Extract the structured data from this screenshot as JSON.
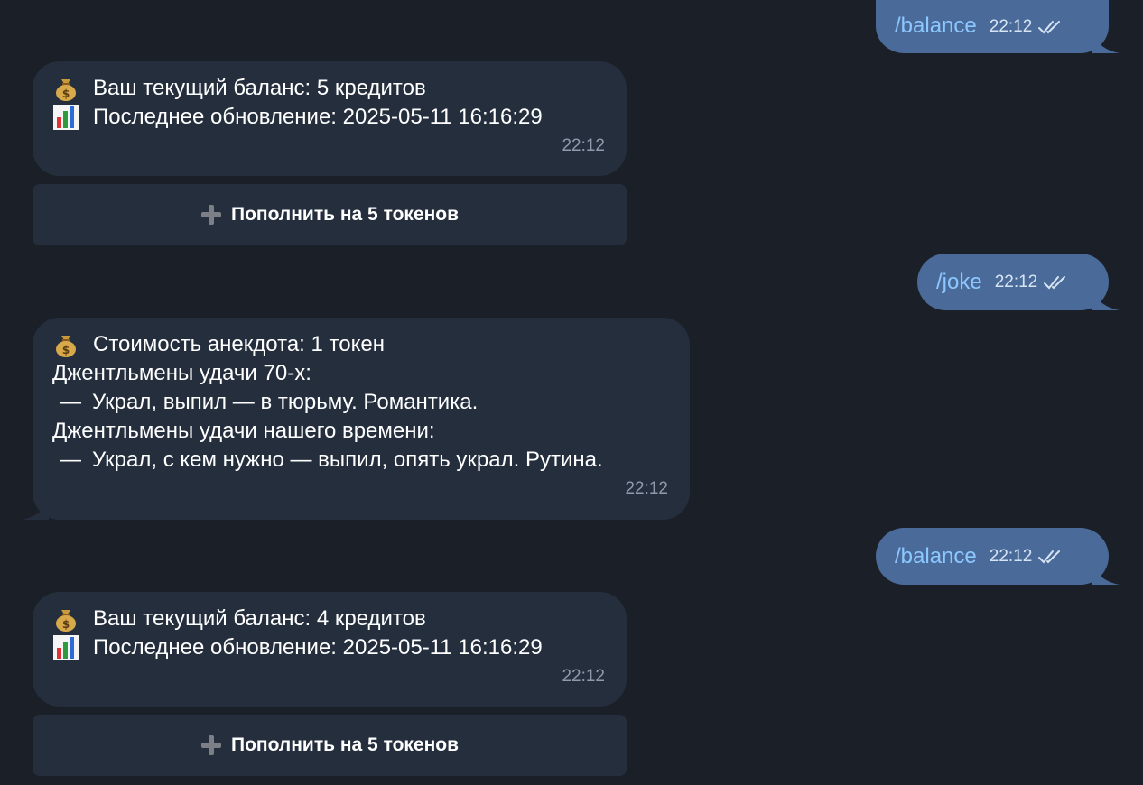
{
  "messages": {
    "out1": {
      "text": "/balance",
      "time": "22:12"
    },
    "in1": {
      "line1": "Ваш текущий баланс: 5 кредитов",
      "line2": "Последнее обновление: 2025-05-11 16:16:29",
      "time": "22:12",
      "button": "Пополнить на 5 токенов"
    },
    "out2": {
      "text": "/joke",
      "time": "22:12"
    },
    "in2": {
      "line1": "Стоимость анекдота: 1 токен",
      "line2": "Джентльмены удачи 70-х:",
      "line3": "Украл, выпил — в тюрьму. Романтика.",
      "line4": "Джентльмены удачи нашего времени:",
      "line5": "Украл, с кем нужно — выпил, опять украл. Рутина.",
      "dash": "—",
      "time": "22:12"
    },
    "out3": {
      "text": "/balance",
      "time": "22:12"
    },
    "in3": {
      "line1": "Ваш текущий баланс: 4 кредитов",
      "line2": "Последнее обновление: 2025-05-11 16:16:29",
      "time": "22:12",
      "button": "Пополнить на 5 токенов"
    }
  },
  "icons": {
    "money_bag": "money-bag-icon",
    "bar_chart": "bar-chart-icon",
    "plus": "plus-icon",
    "read_checks": "double-check-icon"
  },
  "colors": {
    "background": "#1b1f27",
    "incoming_bubble": "#242e3d",
    "outgoing_bubble": "#4a6b9a",
    "command_text": "#8cc8ff"
  }
}
